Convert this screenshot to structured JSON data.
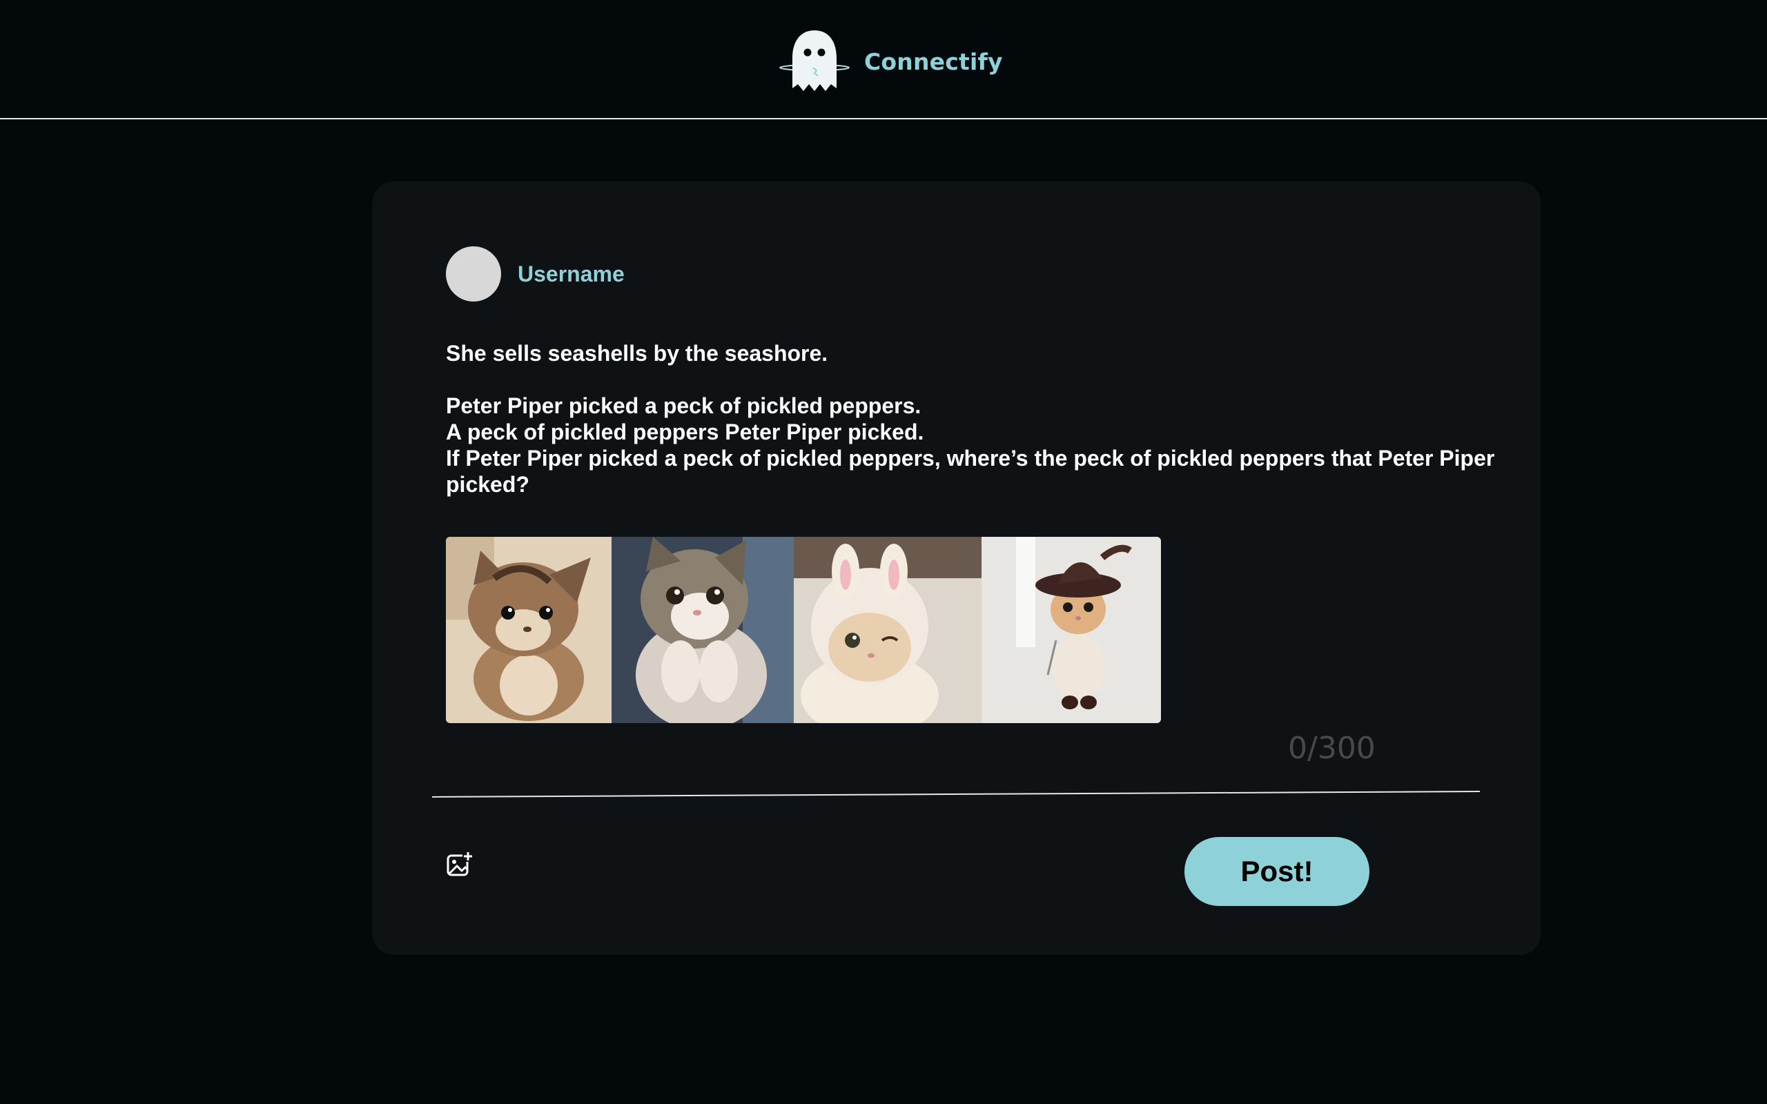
{
  "header": {
    "brand_name": "Connectify",
    "logo_icon": "ghost-icon"
  },
  "post": {
    "username": "Username",
    "text_lines": [
      "She sells seashells by the seashore.",
      "",
      "Peter Piper picked a peck of pickled peppers.",
      "A peck of pickled peppers Peter Piper picked.",
      "If Peter Piper picked a peck of pickled peppers, where’s the peck of pickled peppers that Peter Piper picked?"
    ],
    "images": [
      {
        "icon": "kitten-photo"
      },
      {
        "icon": "kitten-photo"
      },
      {
        "icon": "kitten-photo"
      },
      {
        "icon": "kitten-photo"
      }
    ],
    "char_counter": "0/300"
  },
  "actions": {
    "add_image_icon": "add-image-icon",
    "post_label": "Post!"
  },
  "colors": {
    "background": "#03080a",
    "card": "#0f1214",
    "accent": "#8fd1d8",
    "counter": "#454a4d"
  }
}
